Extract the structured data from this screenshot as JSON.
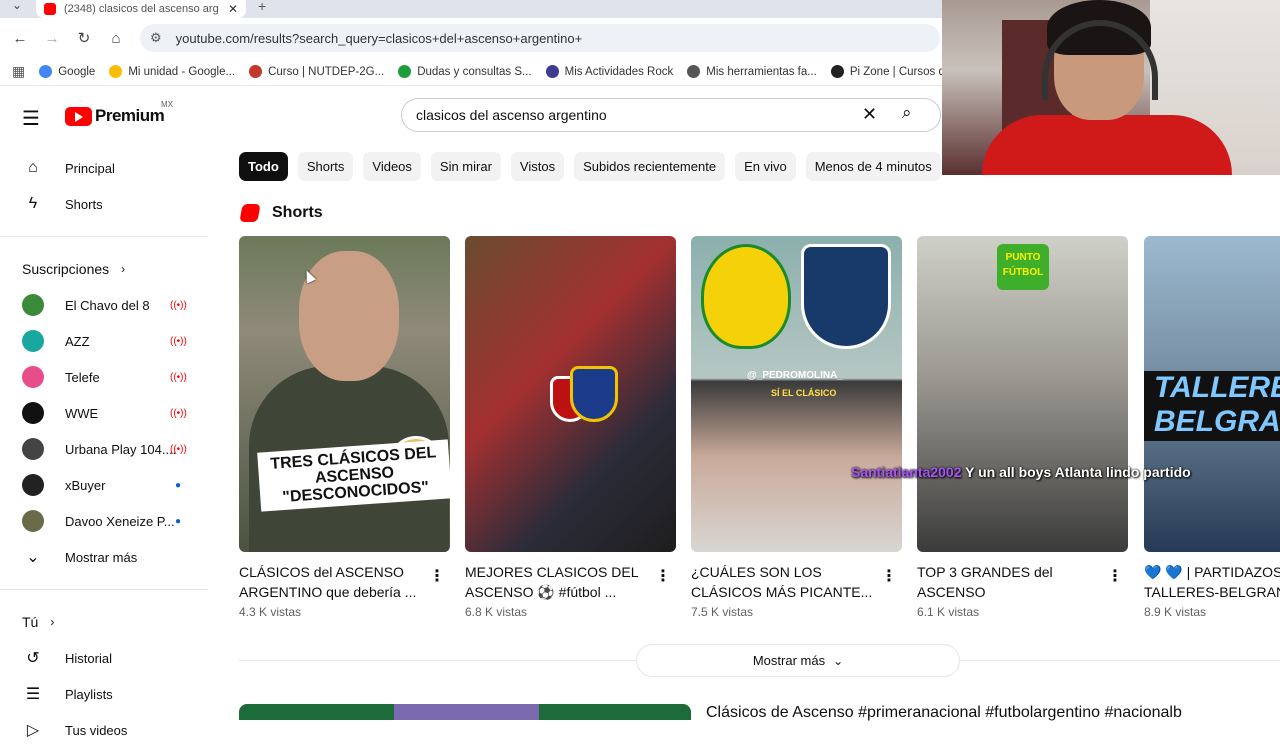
{
  "browser": {
    "tab_title": "(2348) clasicos del ascenso arg",
    "url": "youtube.com/results?search_query=clasicos+del+ascenso+argentino+",
    "bookmarks": [
      {
        "label": "Google",
        "color": "#4285f4"
      },
      {
        "label": "Mi unidad - Google...",
        "color": "#fbbc04"
      },
      {
        "label": "Curso | NUTDEP-2G...",
        "color": "#c0392b"
      },
      {
        "label": "Dudas y consultas S...",
        "color": "#1e9e3a"
      },
      {
        "label": "Mis Actividades Rock",
        "color": "#3b3b8f"
      },
      {
        "label": "Mis herramientas fa...",
        "color": "#555555"
      },
      {
        "label": "Pi Zone | Cursos de...",
        "color": "#222222"
      }
    ]
  },
  "header": {
    "brand": "Premium",
    "country": "MX",
    "search_value": "clasicos del ascenso argentino"
  },
  "sidebar": {
    "main": [
      {
        "label": "Principal",
        "icon": "home-icon"
      },
      {
        "label": "Shorts",
        "icon": "shorts-icon"
      }
    ],
    "subs_title": "Suscripciones",
    "subs": [
      {
        "label": "El Chavo del 8",
        "color": "#3a8a3a",
        "status": "live"
      },
      {
        "label": "AZZ",
        "color": "#1aa7a0",
        "status": "live"
      },
      {
        "label": "Telefe",
        "color": "#e84c8a",
        "status": "live"
      },
      {
        "label": "WWE",
        "color": "#111111",
        "status": "live"
      },
      {
        "label": "Urbana Play 104....",
        "color": "#444444",
        "status": "live"
      },
      {
        "label": "xBuyer",
        "color": "#222222",
        "status": "new"
      },
      {
        "label": "Davoo Xeneize P...",
        "color": "#6b6b4a",
        "status": "new"
      }
    ],
    "show_more": "Mostrar más",
    "you_title": "Tú",
    "you": [
      {
        "label": "Historial",
        "icon": "history-icon"
      },
      {
        "label": "Playlists",
        "icon": "playlists-icon"
      },
      {
        "label": "Tus videos",
        "icon": "videos-icon"
      }
    ]
  },
  "chips": [
    "Todo",
    "Shorts",
    "Videos",
    "Sin mirar",
    "Vistos",
    "Subidos recientemente",
    "En vivo",
    "Menos de 4 minutos"
  ],
  "shorts_section": {
    "title": "Shorts",
    "items": [
      {
        "title": "CLÁSICOS del ASCENSO ARGENTINO que debería ...",
        "views": "4.3 K vistas",
        "caption": "TRES CLÁSICOS DEL ASCENSO \"DESCONOCIDOS\""
      },
      {
        "title": "MEJORES CLASICOS DEL ASCENSO ⚽ #fútbol ...",
        "views": "6.8 K vistas"
      },
      {
        "title": "¿CUÁLES SON LOS CLÁSICOS MÁS PICANTE...",
        "views": "7.5 K vistas",
        "tag": "@_PEDROMOLINA_",
        "tag2": "SÍ EL CLÁSICO"
      },
      {
        "title": "TOP 3 GRANDES del ASCENSO",
        "views": "6.1 K vistas",
        "logo_text": "PUNTO FÚTBOL"
      },
      {
        "title": "💙 💙 | PARTIDAZOS: TALLERES-BELGRANO",
        "views": "8.9 K vistas",
        "band_text": "TALLERES BELGRANO"
      }
    ],
    "show_more": "Mostrar más"
  },
  "chat_overlay": {
    "user": "Santiatlanta2002",
    "message": "Y un all boys Atlanta lindo partido"
  },
  "next_video": {
    "title": "Clásicos de Ascenso #primeranacional #futbolargentino #nacionalb"
  }
}
